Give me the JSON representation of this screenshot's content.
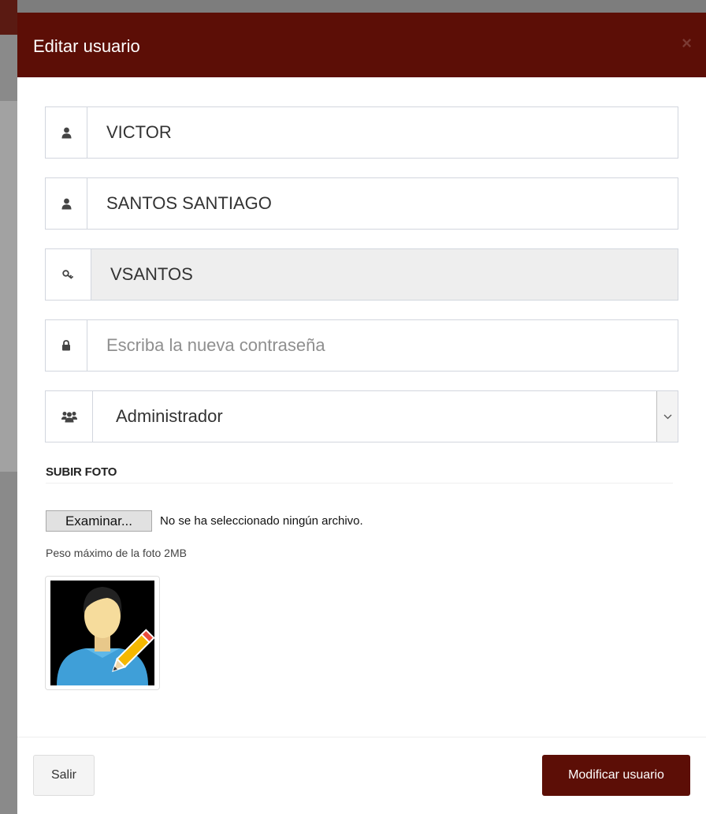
{
  "modal": {
    "title": "Editar usuario",
    "close_glyph": "×"
  },
  "form": {
    "first_name": {
      "icon": "user-icon",
      "value": "VICTOR"
    },
    "last_name": {
      "icon": "user-icon",
      "value": "SANTOS SANTIAGO"
    },
    "username": {
      "icon": "key-icon",
      "value": "VSANTOS",
      "readonly": true
    },
    "password": {
      "icon": "lock-icon",
      "value": "",
      "placeholder": "Escriba la nueva contraseña"
    },
    "role": {
      "icon": "users-icon",
      "selected": "Administrador"
    }
  },
  "photo": {
    "section_title": "SUBIR FOTO",
    "browse_label": "Examinar...",
    "file_status": "No se ha seleccionado ningún archivo.",
    "hint": "Peso máximo de la foto 2MB",
    "preview_icon": "user-edit-avatar"
  },
  "footer": {
    "exit_label": "Salir",
    "submit_label": "Modificar usuario"
  },
  "colors": {
    "header_bg": "#5c0e06",
    "submit_bg": "#5c0e06",
    "readonly_bg": "#eeeeee"
  }
}
